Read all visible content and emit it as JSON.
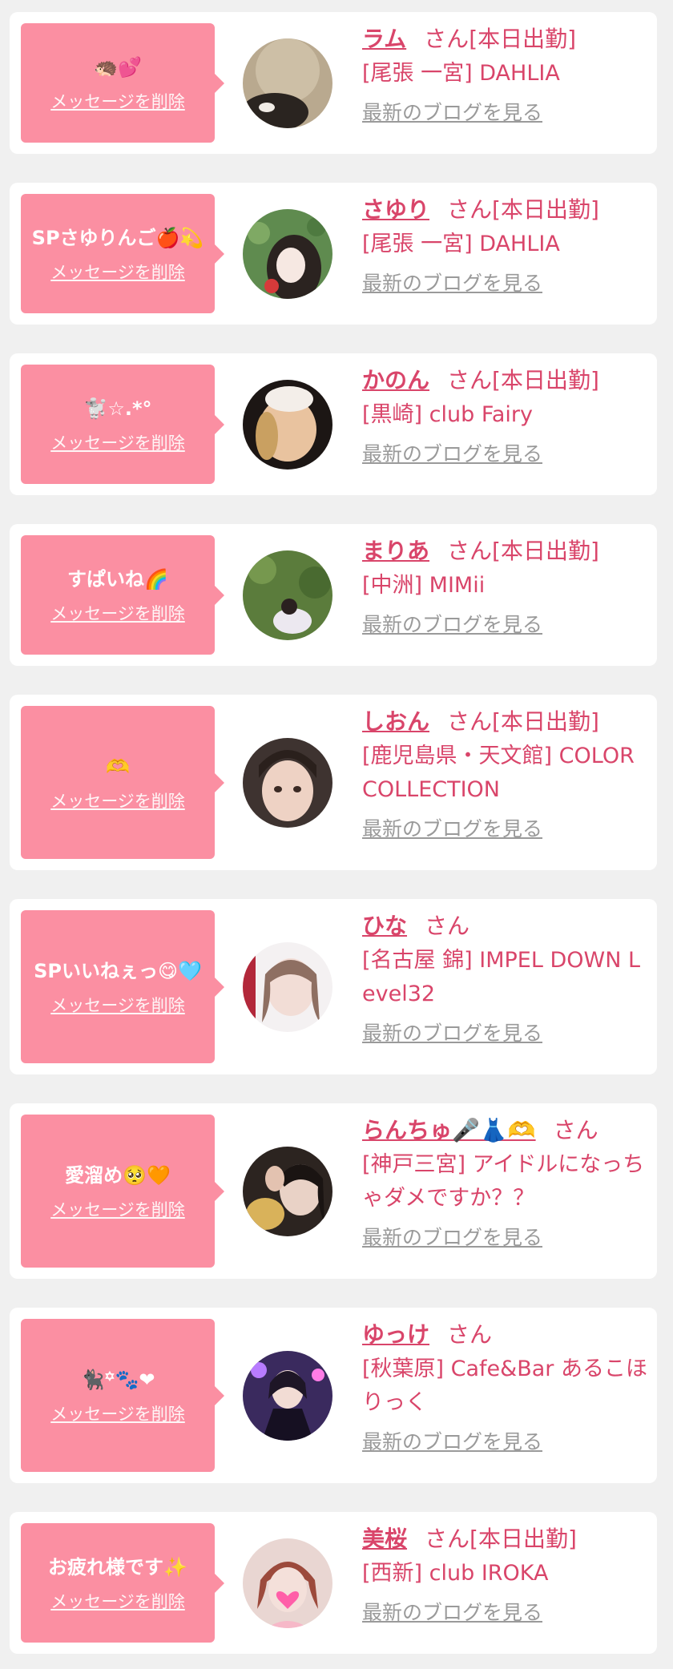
{
  "common": {
    "delete_label": "メッセージを削除",
    "blog_label": "最新のブログを見る",
    "san": "さん"
  },
  "accent_colors": {
    "bubble": "#fb8fa2",
    "name_text": "#d9456a",
    "link_gray": "#9a9a9a",
    "background": "#f0f0f0"
  },
  "items": [
    {
      "message": "🦔💕",
      "name": "ラム",
      "status": "[本日出勤]",
      "shop": "[尾張 一宮] DAHLIA"
    },
    {
      "message": "SPさゆりんご🍎💫",
      "name": "さゆり",
      "status": "[本日出勤]",
      "shop": "[尾張 一宮] DAHLIA"
    },
    {
      "message": "🐩☆.*°",
      "name": "かのん",
      "status": "[本日出勤]",
      "shop": "[黒崎] club Fairy"
    },
    {
      "message": "すぱいね🌈",
      "name": "まりあ",
      "status": "[本日出勤]",
      "shop": "[中洲] MIMii"
    },
    {
      "message": "🫶",
      "name": "しおん",
      "status": "[本日出勤]",
      "shop": "[鹿児島県・天文館] COLOR COLLECTION"
    },
    {
      "message": "SPいいねぇっ😋🩵",
      "name": "ひな",
      "status": "",
      "shop": "[名古屋 錦] IMPEL DOWN Level32"
    },
    {
      "message": "愛溜め🥺🧡",
      "name": "らんちゅ🎤👗🫶",
      "status": "",
      "shop": "[神戸三宮] アイドルになっちゃダメですか？？"
    },
    {
      "message": "🐈‍⬛꙳🐾❤",
      "name": "ゆっけ",
      "status": "",
      "shop": "[秋葉原] Cafe&Bar あるこほりっく"
    },
    {
      "message": "お疲れ様です✨",
      "name": "美桜",
      "status": "[本日出勤]",
      "shop": "[西新] club IROKA"
    }
  ]
}
